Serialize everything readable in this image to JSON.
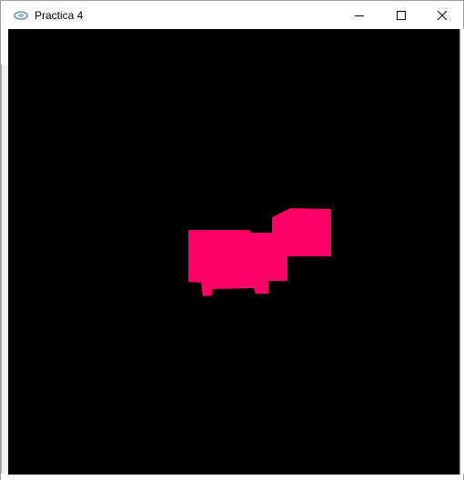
{
  "window": {
    "title": "Practica 4",
    "app_icon": "opengl-glut-icon",
    "controls": {
      "minimize_icon": "minimize-icon",
      "maximize_icon": "maximize-icon",
      "close_icon": "close-icon"
    }
  },
  "scene": {
    "background_color": "#000000",
    "object_color": "#ff0066",
    "object_description_icon": "pink-box-dog-model"
  }
}
